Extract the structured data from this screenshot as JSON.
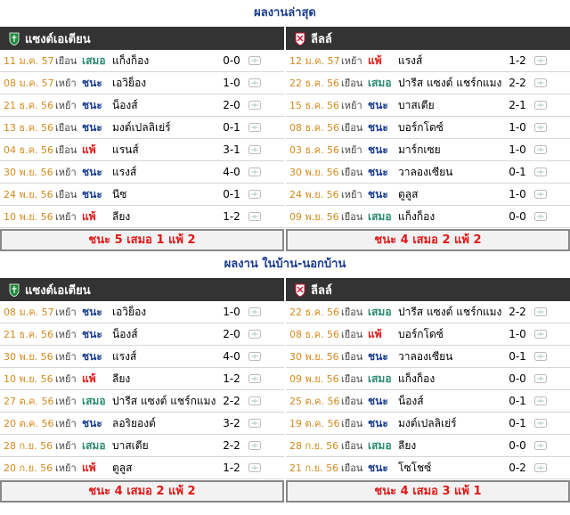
{
  "sections": [
    {
      "title": "ผลงานล่าสุด",
      "left": {
        "team": "แซงต์เอเตียน",
        "rows": [
          {
            "date": "11 ม.ค. 57",
            "venue": "เยือน",
            "result": "เสมอ",
            "kind": "draw",
            "opponent": "แก็งก็อง",
            "score": "0-0"
          },
          {
            "date": "08 ม.ค. 57",
            "venue": "เหย้า",
            "result": "ชนะ",
            "kind": "win",
            "opponent": "เอวิย็อง",
            "score": "1-0"
          },
          {
            "date": "21 ธ.ค. 56",
            "venue": "เหย้า",
            "result": "ชนะ",
            "kind": "win",
            "opponent": "น็องส์",
            "score": "2-0"
          },
          {
            "date": "13 ธ.ค. 56",
            "venue": "เยือน",
            "result": "ชนะ",
            "kind": "win",
            "opponent": "มงต์เปลลิเย่ร์",
            "score": "0-1"
          },
          {
            "date": "04 ธ.ค. 56",
            "venue": "เยือน",
            "result": "แพ้",
            "kind": "loss",
            "opponent": "แรนส์",
            "score": "3-1"
          },
          {
            "date": "30 พ.ย. 56",
            "venue": "เหย้า",
            "result": "ชนะ",
            "kind": "win",
            "opponent": "แรงส์",
            "score": "4-0"
          },
          {
            "date": "24 พ.ย. 56",
            "venue": "เยือน",
            "result": "ชนะ",
            "kind": "win",
            "opponent": "นีซ",
            "score": "0-1"
          },
          {
            "date": "10 พ.ย. 56",
            "venue": "เหย้า",
            "result": "แพ้",
            "kind": "loss",
            "opponent": "ลียง",
            "score": "1-2"
          }
        ],
        "summary": "ชนะ 5 เสมอ 1 แพ้ 2"
      },
      "right": {
        "team": "ลีลล์",
        "rows": [
          {
            "date": "12 ม.ค. 57",
            "venue": "เหย้า",
            "result": "แพ้",
            "kind": "loss",
            "opponent": "แรงส์",
            "score": "1-2"
          },
          {
            "date": "22 ธ.ค. 56",
            "venue": "เยือน",
            "result": "เสมอ",
            "kind": "draw",
            "opponent": "ปารีส แซงต์ แชร์กแมง",
            "score": "2-2"
          },
          {
            "date": "15 ธ.ค. 56",
            "venue": "เหย้า",
            "result": "ชนะ",
            "kind": "win",
            "opponent": "บาสเตีย",
            "score": "2-1"
          },
          {
            "date": "08 ธ.ค. 56",
            "venue": "เยือน",
            "result": "ชนะ",
            "kind": "win",
            "opponent": "บอร์กโดซ์",
            "score": "1-0"
          },
          {
            "date": "03 ธ.ค. 56",
            "venue": "เหย้า",
            "result": "ชนะ",
            "kind": "win",
            "opponent": "มาร์กเซย",
            "score": "1-0"
          },
          {
            "date": "30 พ.ย. 56",
            "venue": "เยือน",
            "result": "ชนะ",
            "kind": "win",
            "opponent": "วาลองเซียน",
            "score": "0-1"
          },
          {
            "date": "24 พ.ย. 56",
            "venue": "เหย้า",
            "result": "ชนะ",
            "kind": "win",
            "opponent": "ตูลูส",
            "score": "1-0"
          },
          {
            "date": "09 พ.ย. 56",
            "venue": "เยือน",
            "result": "เสมอ",
            "kind": "draw",
            "opponent": "แก็งก็อง",
            "score": "0-0"
          }
        ],
        "summary": "ชนะ 4 เสมอ 2 แพ้ 2"
      }
    },
    {
      "title": "ผลงาน ในบ้าน-นอกบ้าน",
      "left": {
        "team": "แซงต์เอเตียน",
        "rows": [
          {
            "date": "08 ม.ค. 57",
            "venue": "เหย้า",
            "result": "ชนะ",
            "kind": "win",
            "opponent": "เอวิย็อง",
            "score": "1-0"
          },
          {
            "date": "21 ธ.ค. 56",
            "venue": "เหย้า",
            "result": "ชนะ",
            "kind": "win",
            "opponent": "น็องส์",
            "score": "2-0"
          },
          {
            "date": "30 พ.ย. 56",
            "venue": "เหย้า",
            "result": "ชนะ",
            "kind": "win",
            "opponent": "แรงส์",
            "score": "4-0"
          },
          {
            "date": "10 พ.ย. 56",
            "venue": "เหย้า",
            "result": "แพ้",
            "kind": "loss",
            "opponent": "ลียง",
            "score": "1-2"
          },
          {
            "date": "27 ต.ค. 56",
            "venue": "เหย้า",
            "result": "เสมอ",
            "kind": "draw",
            "opponent": "ปารีส แซงต์ แชร์กแมง",
            "score": "2-2"
          },
          {
            "date": "20 ต.ค. 56",
            "venue": "เหย้า",
            "result": "ชนะ",
            "kind": "win",
            "opponent": "ลอริยองต์",
            "score": "3-2"
          },
          {
            "date": "28 ก.ย. 56",
            "venue": "เหย้า",
            "result": "เสมอ",
            "kind": "draw",
            "opponent": "บาสเตีย",
            "score": "2-2"
          },
          {
            "date": "20 ก.ย. 56",
            "venue": "เหย้า",
            "result": "แพ้",
            "kind": "loss",
            "opponent": "ตูลูส",
            "score": "1-2"
          }
        ],
        "summary": "ชนะ 4 เสมอ 2 แพ้ 2"
      },
      "right": {
        "team": "ลีลล์",
        "rows": [
          {
            "date": "22 ธ.ค. 56",
            "venue": "เยือน",
            "result": "เสมอ",
            "kind": "draw",
            "opponent": "ปารีส แซงต์ แชร์กแมง",
            "score": "2-2"
          },
          {
            "date": "08 ธ.ค. 56",
            "venue": "เยือน",
            "result": "แพ้",
            "kind": "loss",
            "opponent": "บอร์กโดซ์",
            "score": "1-0"
          },
          {
            "date": "30 พ.ย. 56",
            "venue": "เยือน",
            "result": "ชนะ",
            "kind": "win",
            "opponent": "วาลองเซียน",
            "score": "0-1"
          },
          {
            "date": "09 พ.ย. 56",
            "venue": "เยือน",
            "result": "เสมอ",
            "kind": "draw",
            "opponent": "แก็งก็อง",
            "score": "0-0"
          },
          {
            "date": "25 ต.ค. 56",
            "venue": "เยือน",
            "result": "ชนะ",
            "kind": "win",
            "opponent": "น็องส์",
            "score": "0-1"
          },
          {
            "date": "19 ต.ค. 56",
            "venue": "เยือน",
            "result": "ชนะ",
            "kind": "win",
            "opponent": "มงต์เปลลิเย่ร์",
            "score": "0-1"
          },
          {
            "date": "28 ก.ย. 56",
            "venue": "เยือน",
            "result": "เสมอ",
            "kind": "draw",
            "opponent": "ลียง",
            "score": "0-0"
          },
          {
            "date": "21 ก.ย. 56",
            "venue": "เยือน",
            "result": "ชนะ",
            "kind": "win",
            "opponent": "โซโชซ์",
            "score": "0-2"
          }
        ],
        "summary": "ชนะ 4 เสมอ 3 แพ้ 1"
      }
    }
  ],
  "colors": {
    "win": "#1a3d8f",
    "draw": "#2a8a70",
    "loss": "#e01818",
    "date": "#d48a1e",
    "header_bg": "#333333"
  },
  "icons": {
    "left_team_logo": "saint-etienne-crest-icon",
    "right_team_logo": "lille-crest-icon",
    "row_icon": "match-details-icon"
  }
}
